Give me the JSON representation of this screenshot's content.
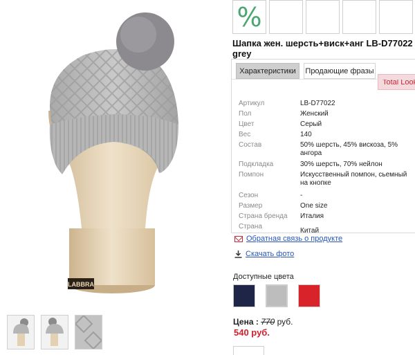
{
  "product": {
    "title": "Шапка жен. шерсть+виск+анг LB-D77022 grey",
    "discount_icon": "%",
    "brand_tag": "LABBRA"
  },
  "tabs": [
    {
      "label": "Характеристики"
    },
    {
      "label": "Продающие фразы"
    },
    {
      "label": "Total Looks"
    }
  ],
  "specs": [
    {
      "label": "Артикул",
      "value": "LB-D77022"
    },
    {
      "label": "Пол",
      "value": "Женский"
    },
    {
      "label": "Цвет",
      "value": "Серый"
    },
    {
      "label": "Вес",
      "value": "140"
    },
    {
      "label": "Состав",
      "value": "50% шерсть, 45% вискоза, 5% ангора"
    },
    {
      "label": "Подкладка",
      "value": "30% шерсть, 70% нейлон"
    },
    {
      "label": "Помпон",
      "value": "Искусственный помпон, сьемный на кнопке"
    },
    {
      "label": "Сезон",
      "value": "-"
    },
    {
      "label": "Размер",
      "value": "One size"
    },
    {
      "label": "Страна бренда",
      "value": "Италия"
    },
    {
      "label": "Страна производства",
      "value": "Китай"
    }
  ],
  "links": {
    "feedback": "Обратная связь о продукте",
    "download": "Скачать фото"
  },
  "colors": {
    "label": "Доступные цвета",
    "swatches": [
      "#1e2547",
      "#bdbdbd",
      "#d8232b"
    ]
  },
  "price": {
    "label": "Цена :",
    "old": "770",
    "currency": "руб.",
    "new": "540 руб."
  }
}
